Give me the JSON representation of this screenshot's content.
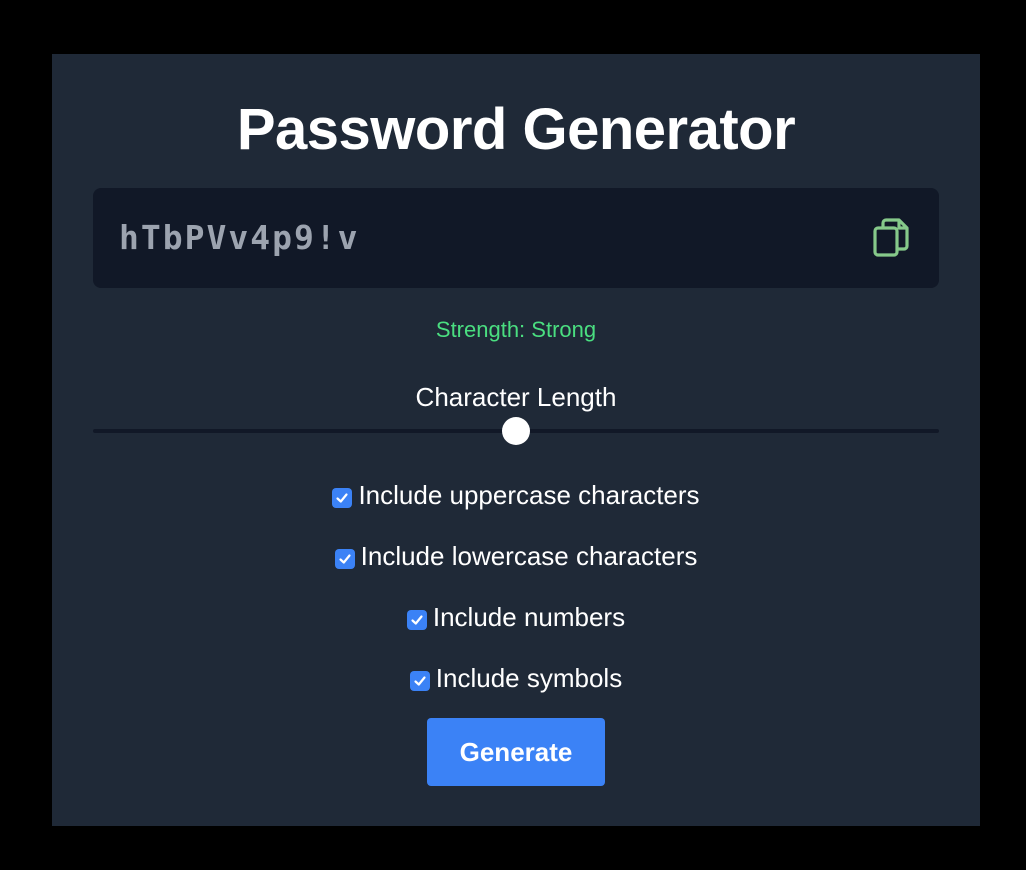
{
  "app": {
    "title": "Password Generator"
  },
  "password": {
    "value": "hTbPVv4p9!v",
    "copy_icon": "copy-icon"
  },
  "strength": {
    "text": "Strength: Strong",
    "color": "#4ade80"
  },
  "length": {
    "label": "Character Length",
    "slider_fraction": 0.5
  },
  "options": [
    {
      "label": "Include uppercase characters",
      "checked": true
    },
    {
      "label": "Include lowercase characters",
      "checked": true
    },
    {
      "label": "Include numbers",
      "checked": true
    },
    {
      "label": "Include symbols",
      "checked": true
    }
  ],
  "actions": {
    "generate_label": "Generate"
  },
  "colors": {
    "background": "#000000",
    "card": "#1f2937",
    "input_bg": "#111827",
    "accent": "#3b82f6",
    "strength": "#4ade80",
    "icon": "#86c98a"
  }
}
